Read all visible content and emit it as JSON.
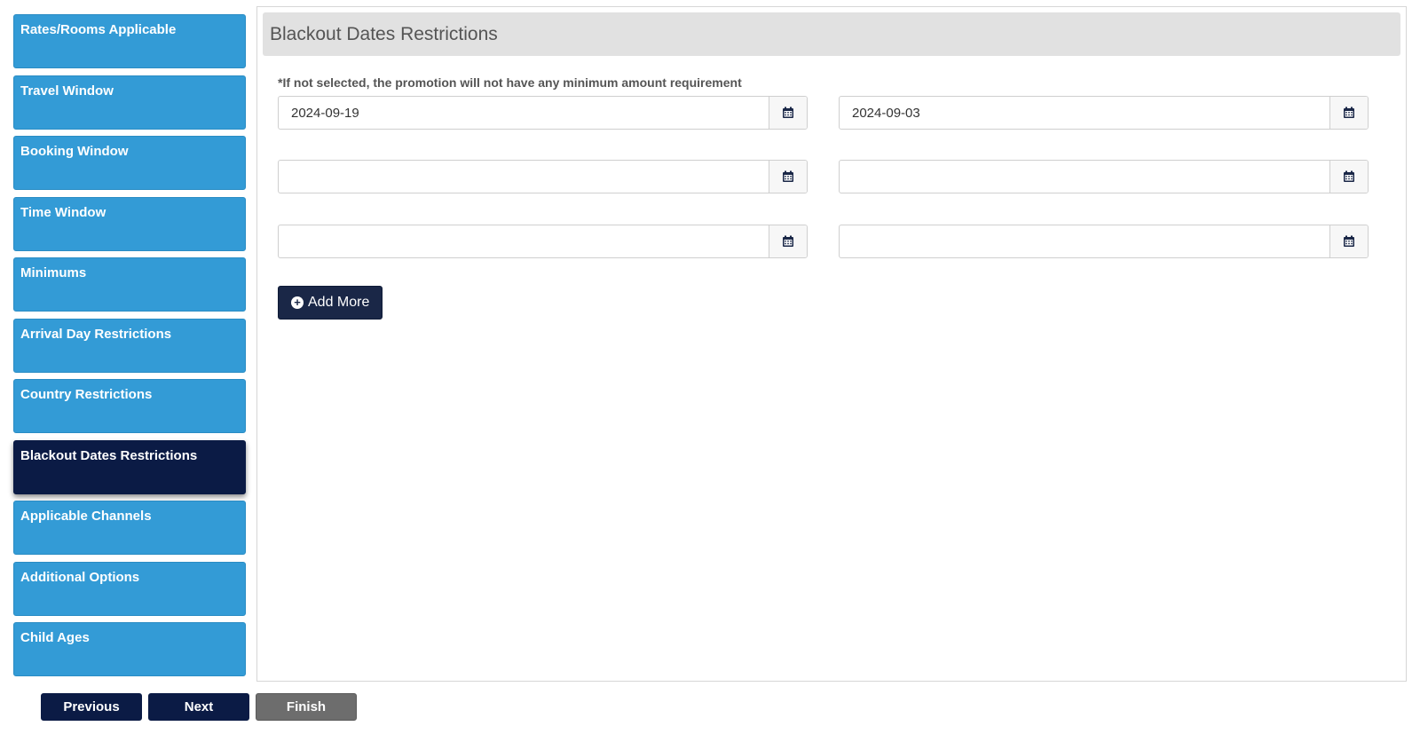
{
  "sidebar": {
    "items": [
      {
        "label": "Rates/Rooms Applicable"
      },
      {
        "label": "Travel Window"
      },
      {
        "label": "Booking Window"
      },
      {
        "label": "Time Window"
      },
      {
        "label": "Minimums"
      },
      {
        "label": "Arrival Day Restrictions"
      },
      {
        "label": "Country Restrictions"
      },
      {
        "label": "Blackout Dates Restrictions",
        "active": true
      },
      {
        "label": "Applicable Channels"
      },
      {
        "label": "Additional Options"
      },
      {
        "label": "Child Ages"
      }
    ]
  },
  "main": {
    "title": "Blackout Dates Restrictions",
    "note": "*If not selected, the promotion will not have any minimum amount requirement",
    "date_rows": [
      {
        "start": "2024-09-19",
        "end": "2024-09-03"
      },
      {
        "start": "",
        "end": ""
      },
      {
        "start": "",
        "end": ""
      }
    ],
    "add_more_label": "Add More"
  },
  "footer": {
    "previous_label": "Previous",
    "next_label": "Next",
    "finish_label": "Finish"
  },
  "icons": {
    "calendar": "calendar-icon",
    "add": "plus-circle-icon"
  },
  "colors": {
    "sidebar_item": "#339bd6",
    "sidebar_active": "#0b1b45",
    "primary_button": "#0b1b45",
    "finish_button": "#6d6d6d"
  }
}
